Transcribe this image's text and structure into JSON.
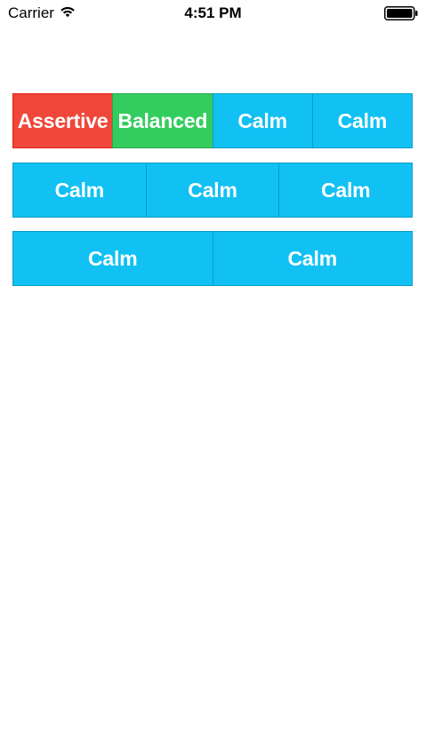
{
  "status_bar": {
    "carrier": "Carrier",
    "time": "4:51 PM",
    "wifi_icon": "wifi-icon",
    "battery_icon": "battery-icon"
  },
  "colors": {
    "assertive": "#ef473a",
    "balanced": "#33cd5f",
    "calm": "#11c1f3"
  },
  "button_bars": [
    {
      "buttons": [
        {
          "label": "Assertive",
          "style": "assertive"
        },
        {
          "label": "Balanced",
          "style": "balanced"
        },
        {
          "label": "Calm",
          "style": "calm"
        },
        {
          "label": "Calm",
          "style": "calm"
        }
      ]
    },
    {
      "buttons": [
        {
          "label": "Calm",
          "style": "calm"
        },
        {
          "label": "Calm",
          "style": "calm"
        },
        {
          "label": "Calm",
          "style": "calm"
        }
      ]
    },
    {
      "buttons": [
        {
          "label": "Calm",
          "style": "calm"
        },
        {
          "label": "Calm",
          "style": "calm"
        }
      ]
    }
  ]
}
